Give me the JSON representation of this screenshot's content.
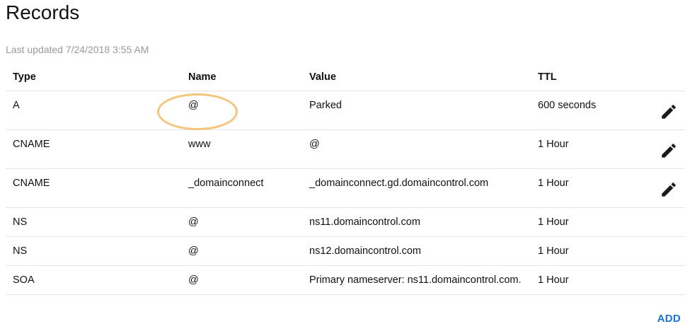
{
  "page": {
    "title": "Records",
    "last_updated": "Last updated 7/24/2018 3:55 AM"
  },
  "table": {
    "headers": {
      "type": "Type",
      "name": "Name",
      "value": "Value",
      "ttl": "TTL"
    },
    "rows": [
      {
        "type": "A",
        "name": "@",
        "value": "Parked",
        "ttl": "600 seconds",
        "editable": true
      },
      {
        "type": "CNAME",
        "name": "www",
        "value": "@",
        "ttl": "1 Hour",
        "editable": true
      },
      {
        "type": "CNAME",
        "name": "_domainconnect",
        "value": "_domainconnect.gd.domaincontrol.com",
        "ttl": "1 Hour",
        "editable": true
      },
      {
        "type": "NS",
        "name": "@",
        "value": "ns11.domaincontrol.com",
        "ttl": "1 Hour",
        "editable": false
      },
      {
        "type": "NS",
        "name": "@",
        "value": "ns12.domaincontrol.com",
        "ttl": "1 Hour",
        "editable": false
      },
      {
        "type": "SOA",
        "name": "@",
        "value": "Primary nameserver: ns11.domaincontrol.com.",
        "ttl": "1 Hour",
        "editable": false
      }
    ]
  },
  "actions": {
    "add_label": "ADD",
    "edit_icon": "pencil-icon"
  },
  "colors": {
    "accent": "#1a73c9",
    "highlight": "#f5c57e",
    "muted_text": "#9a9a9a",
    "divider": "#e3e3e3"
  }
}
